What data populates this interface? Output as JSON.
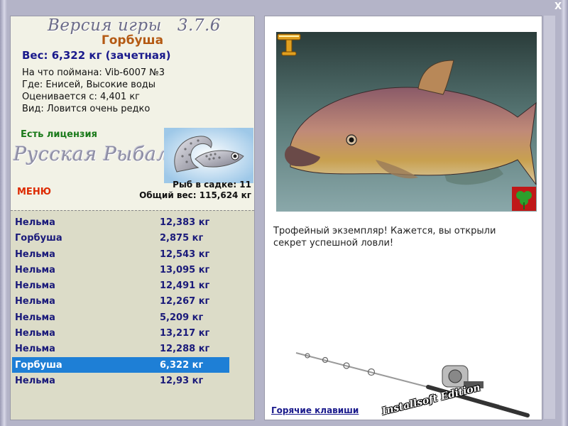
{
  "window": {
    "close_label": "X"
  },
  "header": {
    "version_label": "Версия игры",
    "version_number": "3.7.6"
  },
  "fish": {
    "name": "Горбуша",
    "weight_line": "Вес: 6,322 кг (зачетная)",
    "bait_line": "На что поймана: Vib-6007 №3",
    "location_line": "Где: Енисей, Высокие воды",
    "value_line": "Оценивается с: 4,401 кг",
    "rarity_line": "Вид: Ловится очень редко"
  },
  "license_label": "Есть лицензия",
  "logo_text": "Русская Рыбалка",
  "menu_label": "МЕНЮ",
  "stats": {
    "fish_count_line": "Рыб в садке: 11",
    "total_weight_line": "Общий вес: 115,624 кг"
  },
  "catch_list": [
    {
      "name": "Нельма",
      "weight": "12,383 кг"
    },
    {
      "name": "Горбуша",
      "weight": "2,875 кг"
    },
    {
      "name": "Нельма",
      "weight": "12,543 кг"
    },
    {
      "name": "Нельма",
      "weight": "13,095 кг"
    },
    {
      "name": "Нельма",
      "weight": "12,491 кг"
    },
    {
      "name": "Нельма",
      "weight": "12,267 кг"
    },
    {
      "name": "Нельма",
      "weight": "5,209 кг"
    },
    {
      "name": "Нельма",
      "weight": "13,217 кг"
    },
    {
      "name": "Нельма",
      "weight": "12,288 кг"
    },
    {
      "name": "Горбуша",
      "weight": "6,322 кг",
      "selected": true
    },
    {
      "name": "Нельма",
      "weight": "12,93 кг"
    }
  ],
  "description": "Трофейный экземпляр! Кажется, вы открыли секрет успешной ловли!",
  "hotkeys_label": "Горячие клавиши",
  "edition_label": "Installsoft Edition",
  "icons": {
    "trophy": "trophy-icon",
    "clover": "clover-icon",
    "close": "close-icon"
  },
  "colors": {
    "selected_row": "#1e7fd6",
    "fish_name": "#b45a14",
    "menu": "#dd2a00",
    "license": "#1a7a1a"
  }
}
